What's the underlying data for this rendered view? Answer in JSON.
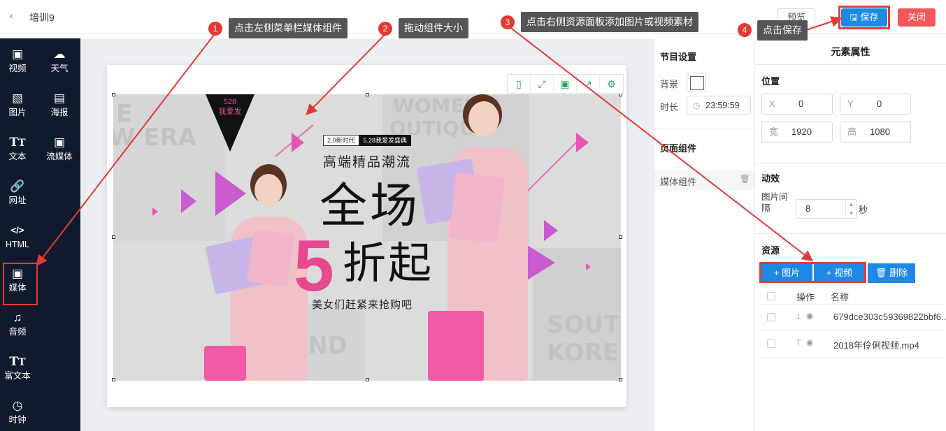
{
  "header": {
    "back_icon": "chevron-left-icon",
    "title": "培训9",
    "preview": "预览",
    "save": "保存",
    "close": "关闭",
    "save_color": "#1e88e5",
    "close_color": "#f5565a"
  },
  "sidebar": {
    "background": "#0f1b2d",
    "items": [
      {
        "label": "视频",
        "icon": "video-icon"
      },
      {
        "label": "天气",
        "icon": "cloud-icon"
      },
      {
        "label": "图片",
        "icon": "image-icon"
      },
      {
        "label": "海报",
        "icon": "poster-icon"
      },
      {
        "label": "文本",
        "icon": "text-icon"
      },
      {
        "label": "流媒体",
        "icon": "stream-icon"
      },
      {
        "label": "网址",
        "icon": "link-icon"
      },
      {
        "label": "HTML",
        "icon": "code-icon"
      },
      {
        "label": "媒体",
        "icon": "media-icon"
      },
      {
        "label": "音频",
        "icon": "music-icon"
      },
      {
        "label": "富文本",
        "icon": "rich-text-icon"
      },
      {
        "label": "时钟",
        "icon": "clock-icon"
      }
    ]
  },
  "banner": {
    "badge_num": "528",
    "badge_text": "我爱发",
    "tag_left": "2.0新时代",
    "tag_right": "5.28我爱发盛典",
    "subtitle": "高端精品潮流",
    "line1": "全场",
    "big_num": "5",
    "line2": "折起",
    "cta": "美女们赶紧来抢购吧",
    "bg_words": [
      "E",
      "W ERA",
      "WOMEN'S",
      "OUTIQUE",
      "END",
      "SOUT",
      "KORE"
    ]
  },
  "canvas_toolbar": [
    "fit-page-icon",
    "fullscreen-icon",
    "save-icon",
    "export-icon",
    "gear-icon"
  ],
  "program": {
    "title": "节目设置",
    "bg_label": "背景",
    "duration_label": "时长",
    "duration": "23:59:59",
    "components_title": "页面组件",
    "component": "媒体组件"
  },
  "props": {
    "title": "元素属性",
    "position_title": "位置",
    "x_label": "X",
    "x": "0",
    "y_label": "Y",
    "y": "0",
    "w_label": "宽",
    "w": "1920",
    "h_label": "高",
    "h": "1080",
    "anim_title": "动效",
    "interval_label": "图片间隔",
    "interval": "8",
    "interval_unit": "秒",
    "res_title": "资源",
    "add_image": "+ 图片",
    "add_video": "+ 视频",
    "delete": "删除",
    "col_op": "操作",
    "col_name": "名称",
    "rows": [
      {
        "name": "679dce303c59369822bbf6..."
      },
      {
        "name": "2018年伶俐视频.mp4"
      }
    ]
  },
  "callouts": [
    {
      "num": "1",
      "text": "点击左侧菜单栏媒体组件"
    },
    {
      "num": "2",
      "text": "拖动组件大小"
    },
    {
      "num": "3",
      "text": "点击右侧资源面板添加图片或视频素材"
    },
    {
      "num": "4",
      "text": "点击保存"
    }
  ]
}
